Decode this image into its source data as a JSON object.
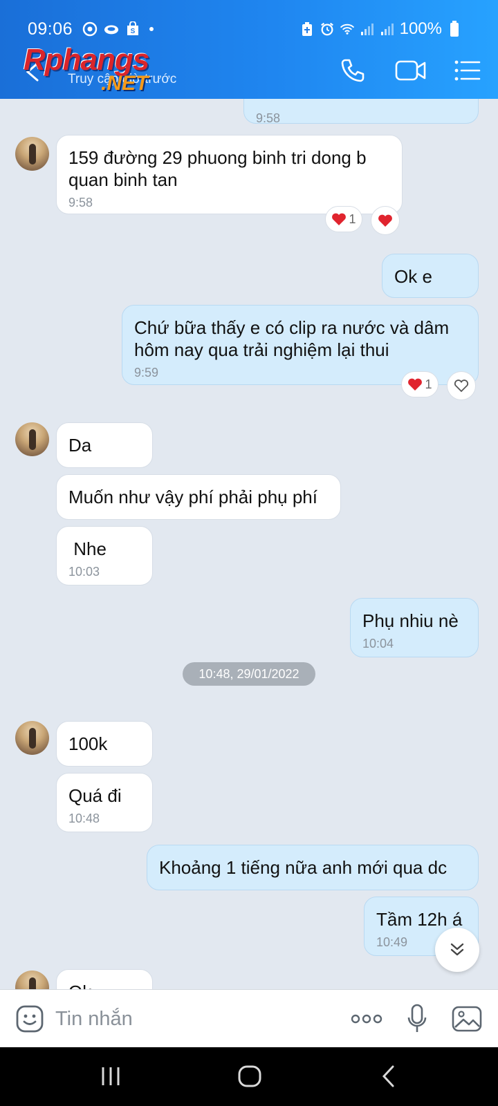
{
  "status_bar": {
    "time": "09:06",
    "battery": "100%",
    "left_icons": [
      "chrome-icon",
      "cloud-icon",
      "shop-icon"
    ],
    "right_icons": [
      "battery-saver-icon",
      "alarm-icon",
      "wifi-icon",
      "signal-icon",
      "signal-icon",
      "battery-icon"
    ]
  },
  "header": {
    "title": "",
    "subtitle": "Truy cập giờ trước",
    "watermark_main": "Rphangs",
    "watermark_sub": ".NET",
    "actions": [
      "phone-icon",
      "video-call-icon",
      "menu-list-icon"
    ]
  },
  "messages": [
    {
      "id": "m0",
      "direction": "out",
      "text": "",
      "time": "9:58"
    },
    {
      "id": "m1",
      "direction": "in",
      "avatar": true,
      "text": "159 đường 29 phuong binh tri dong b quan binh tan",
      "time": "9:58",
      "reactions": [
        {
          "icon": "heart",
          "count": "1"
        },
        {
          "icon": "heart",
          "count": ""
        }
      ]
    },
    {
      "id": "m2",
      "direction": "out",
      "text": "Ok e",
      "time": ""
    },
    {
      "id": "m3",
      "direction": "out",
      "text": "Chứ bữa thấy e có clip ra nước và dâm hôm nay qua trải nghiệm lại thui",
      "time": "9:59",
      "reactions": [
        {
          "icon": "heart",
          "count": "1"
        },
        {
          "icon": "heart-outline",
          "count": ""
        }
      ]
    },
    {
      "id": "m4",
      "direction": "in",
      "avatar": true,
      "text": "Da",
      "time": ""
    },
    {
      "id": "m5",
      "direction": "in",
      "text": "Muốn như vậy phí phải phụ phí",
      "time": ""
    },
    {
      "id": "m6",
      "direction": "in",
      "text": " Nhe",
      "time": "10:03"
    },
    {
      "id": "m7",
      "direction": "out",
      "text": "Phụ nhiu nè",
      "time": "10:04"
    },
    {
      "id": "m8",
      "direction": "in",
      "avatar": true,
      "text": "100k",
      "time": ""
    },
    {
      "id": "m9",
      "direction": "in",
      "text": "Quá đi",
      "time": "10:48"
    },
    {
      "id": "m10",
      "direction": "out",
      "text": "Khoảng 1 tiếng nữa anh mới qua dc",
      "time": ""
    },
    {
      "id": "m11",
      "direction": "out",
      "text": "Tầm 12h á",
      "time": "10:49"
    },
    {
      "id": "m12",
      "direction": "in",
      "avatar": true,
      "text": "Ok",
      "time": ""
    }
  ],
  "date_separator": "10:48, 29/01/2022",
  "composer": {
    "placeholder": "Tin nhắn",
    "icons": [
      "emoji-icon",
      "more-dots-icon",
      "microphone-icon",
      "gallery-icon"
    ]
  },
  "colors": {
    "header_start": "#1a6fd8",
    "header_end": "#27a2ff",
    "chat_background": "#e2e8f0",
    "incoming_bubble": "#ffffff",
    "outgoing_bubble": "#d4ecfc",
    "heart": "#e0242e"
  }
}
